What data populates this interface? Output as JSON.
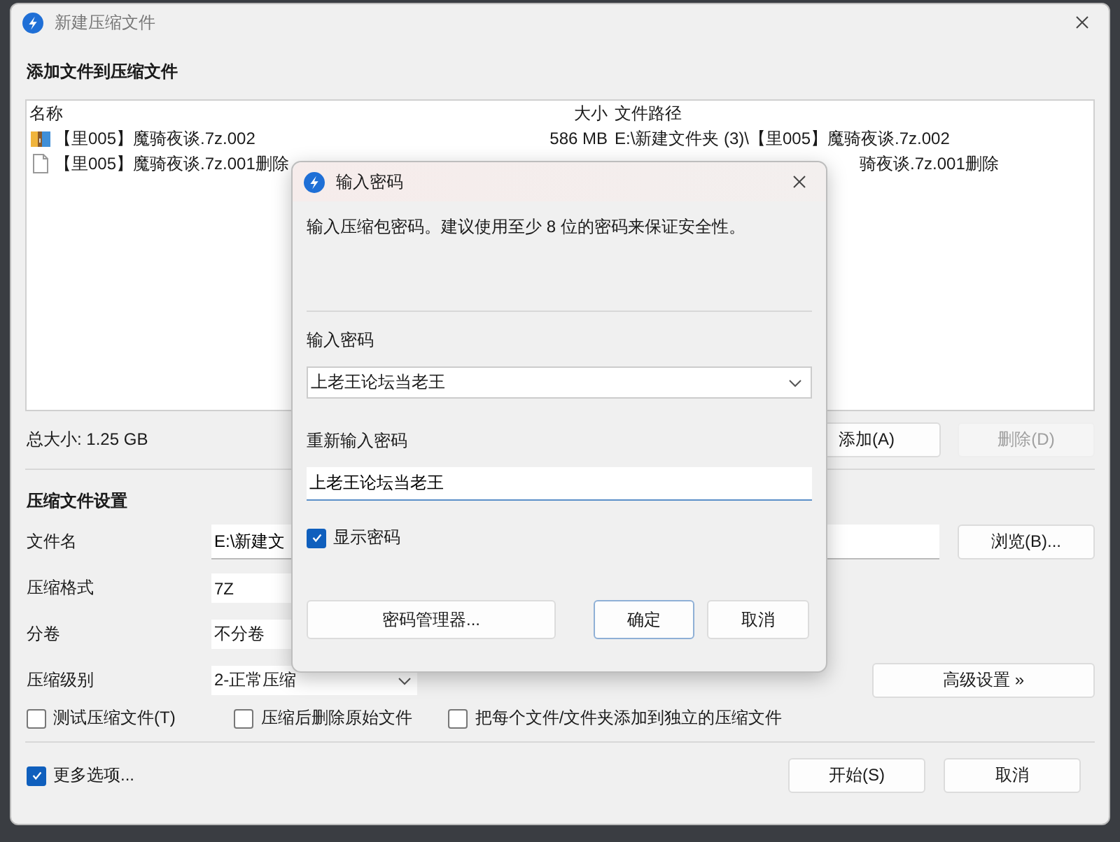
{
  "window": {
    "title": "新建压缩文件"
  },
  "heading": "添加文件到压缩文件",
  "file_list": {
    "columns": [
      "名称",
      "大小",
      "文件路径"
    ],
    "rows": [
      {
        "kind": "archive",
        "name": "【里005】魔骑夜谈.7z.002",
        "size": "586 MB",
        "path": "E:\\新建文件夹 (3)\\【里005】魔骑夜谈.7z.002"
      },
      {
        "kind": "file",
        "name": "【里005】魔骑夜谈.7z.001删除",
        "path": "骑夜谈.7z.001删除"
      }
    ]
  },
  "total_size": "总大小: 1.25 GB",
  "list_buttons": [
    {
      "label": "添加(A)",
      "disabled": false
    },
    {
      "label": "删除(D)",
      "disabled": true
    }
  ],
  "settings": {
    "title": "压缩文件设置",
    "fields": [
      {
        "kind": "text",
        "label": "文件名",
        "value": "E:\\新建文"
      },
      {
        "kind": "combo",
        "label": "压缩格式",
        "value": "7Z"
      },
      {
        "kind": "combo",
        "label": "分卷",
        "value": "不分卷"
      },
      {
        "kind": "combo",
        "label": "压缩级别",
        "value": "2-正常压缩"
      }
    ],
    "browse_button": "浏览(B)...",
    "advanced_button": "高级设置 »",
    "options": [
      {
        "label": "测试压缩文件(T)",
        "checked": false
      },
      {
        "label": "压缩后删除原始文件",
        "checked": false
      },
      {
        "label": "把每个文件/文件夹添加到独立的压缩文件",
        "checked": false
      }
    ]
  },
  "more_options": {
    "label": "更多选项...",
    "checked": true
  },
  "buttons": [
    "开始(S)",
    "取消"
  ],
  "dialog": {
    "title": "输入密码",
    "description": "输入压缩包密码。建议使用至少 8 位的密码来保证安全性。",
    "password_label": "输入密码",
    "password": "上老王论坛当老王",
    "confirm_label": "重新输入密码",
    "confirm": "上老王论坛当老王",
    "show_password": {
      "label": "显示密码",
      "checked": true
    },
    "buttons": [
      {
        "label": "密码管理器...",
        "default": false
      },
      {
        "label": "确定",
        "default": true
      },
      {
        "label": "取消",
        "default": false
      }
    ]
  }
}
